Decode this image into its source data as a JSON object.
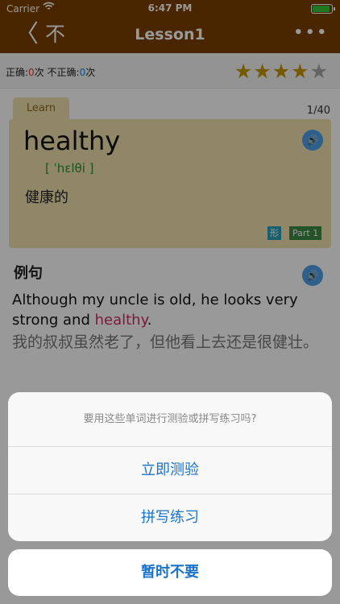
{
  "status": {
    "carrier": "Carrier",
    "wifi_icon": "wifi-icon",
    "time": "6:47 PM",
    "battery_icon": "battery-icon"
  },
  "nav": {
    "back_icon": "chevron-left-icon",
    "back_glyph": "〈",
    "secondary": "不",
    "title": "Lesson1",
    "more": "•••"
  },
  "score": {
    "correct_label": "正确:",
    "correct_value": "0",
    "unit1": "次",
    "wrong_label": "不正确:",
    "wrong_value": "0",
    "unit2": "次",
    "rating": 4,
    "max_rating": 5
  },
  "card": {
    "tab_label": "Learn",
    "counter": "1/40",
    "word": "healthy",
    "phonetic": "[ ˈhɛlθi ]",
    "meaning": "健康的",
    "pos_tag": "形",
    "part_tag": "Part 1",
    "speaker_icon": "speaker-icon"
  },
  "example": {
    "title": "例句",
    "en_before": "Although my uncle is old, he looks very strong and ",
    "en_highlight": "healthy",
    "en_after": ".",
    "zh": "我的叔叔虽然老了，但他看上去还是很健壮。"
  },
  "action_sheet": {
    "prompt": "要用这些单词进行测验或拼写练习吗?",
    "actions": [
      {
        "label": "立即测验"
      },
      {
        "label": "拼写练习"
      }
    ],
    "cancel": "暂时不要"
  },
  "colors": {
    "nav_bg": "#7a3e00",
    "card_bg": "#f0e2ad",
    "action_blue": "#1a73c9",
    "highlight": "#c83060"
  }
}
